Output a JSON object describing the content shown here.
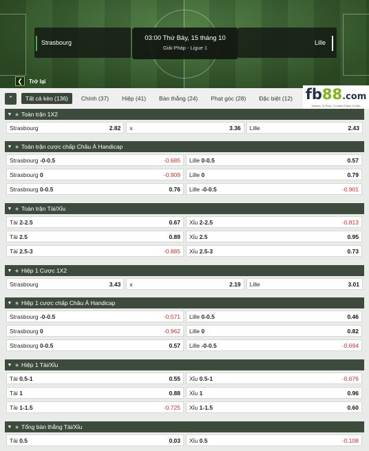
{
  "match": {
    "time": "03:00 Thứ Bảy, 15 tháng 10",
    "league": "Giải Pháp - Ligue 1",
    "home": "Strasbourg",
    "away": "Lille"
  },
  "back_label": "Trở lại",
  "tabs": [
    {
      "label": "Tất cả kèo (136)",
      "active": true
    },
    {
      "label": "Chính (37)"
    },
    {
      "label": "Hiệp (41)"
    },
    {
      "label": "Bàn thắng (24)"
    },
    {
      "label": "Phạt góc (28)"
    },
    {
      "label": "Đặc biệt (12)"
    }
  ],
  "logo": {
    "fb": "fb",
    "n88": "88",
    "com": ".com",
    "tagline": "Games To Play • Trusted Place To Bet"
  },
  "colors": {
    "header_bg": "#3d4b3c",
    "negative": "#d42a2a",
    "brand_green": "#7cb518",
    "active_tab": "#3b463b"
  },
  "sections": [
    {
      "title": "Toàn trận 1X2",
      "type": "1x2",
      "row": [
        {
          "sel": "Strasbourg",
          "odds": "2.82"
        },
        {
          "sel": "x",
          "odds": "3.36"
        },
        {
          "sel": "Lille",
          "odds": "2.43"
        }
      ]
    },
    {
      "title": "Toàn trận cược chấp Châu Á Handicap",
      "type": "pair",
      "rows": [
        [
          {
            "sel": "Strasbourg",
            "line": "-0-0.5",
            "odds": "-0.685"
          },
          {
            "sel": "Lille",
            "line": "0-0.5",
            "odds": "0.57"
          }
        ],
        [
          {
            "sel": "Strasbourg",
            "line": "0",
            "odds": "-0.909"
          },
          {
            "sel": "Lille",
            "line": "0",
            "odds": "0.79"
          }
        ],
        [
          {
            "sel": "Strasbourg",
            "line": "0-0.5",
            "odds": "0.76"
          },
          {
            "sel": "Lille",
            "line": "-0-0.5",
            "odds": "-0.901"
          }
        ]
      ]
    },
    {
      "title": "Toàn trận Tài/Xỉu",
      "type": "pair",
      "rows": [
        [
          {
            "sel": "Tài",
            "line": "2-2.5",
            "odds": "0.67"
          },
          {
            "sel": "Xỉu",
            "line": "2-2.5",
            "odds": "-0.813"
          }
        ],
        [
          {
            "sel": "Tài",
            "line": "2.5",
            "odds": "0.89"
          },
          {
            "sel": "Xỉu",
            "line": "2.5",
            "odds": "0.95"
          }
        ],
        [
          {
            "sel": "Tài",
            "line": "2.5-3",
            "odds": "-0.885"
          },
          {
            "sel": "Xỉu",
            "line": "2.5-3",
            "odds": "0.73"
          }
        ]
      ]
    },
    {
      "title": "Hiệp 1 Cược 1X2",
      "type": "1x2",
      "row": [
        {
          "sel": "Strasbourg",
          "odds": "3.43"
        },
        {
          "sel": "x",
          "odds": "2.19"
        },
        {
          "sel": "Lille",
          "odds": "3.01"
        }
      ]
    },
    {
      "title": "Hiệp 1 cược chấp Châu Á Handicap",
      "type": "pair",
      "rows": [
        [
          {
            "sel": "Strasbourg",
            "line": "-0-0.5",
            "odds": "-0.571"
          },
          {
            "sel": "Lille",
            "line": "0-0.5",
            "odds": "0.46"
          }
        ],
        [
          {
            "sel": "Strasbourg",
            "line": "0",
            "odds": "-0.962"
          },
          {
            "sel": "Lille",
            "line": "0",
            "odds": "0.82"
          }
        ],
        [
          {
            "sel": "Strasbourg",
            "line": "0-0.5",
            "odds": "0.57"
          },
          {
            "sel": "Lille",
            "line": "-0-0.5",
            "odds": "-0.694"
          }
        ]
      ]
    },
    {
      "title": "Hiệp 1 Tài/Xỉu",
      "type": "pair",
      "rows": [
        [
          {
            "sel": "Tài",
            "line": "0.5-1",
            "odds": "0.55"
          },
          {
            "sel": "Xỉu",
            "line": "0.5-1",
            "odds": "-0.676"
          }
        ],
        [
          {
            "sel": "Tài",
            "line": "1",
            "odds": "0.88"
          },
          {
            "sel": "Xỉu",
            "line": "1",
            "odds": "0.96"
          }
        ],
        [
          {
            "sel": "Tài",
            "line": "1-1.5",
            "odds": "-0.725"
          },
          {
            "sel": "Xỉu",
            "line": "1-1.5",
            "odds": "0.60"
          }
        ]
      ]
    },
    {
      "title": "Tổng bàn thắng Tài/Xỉu",
      "type": "pair",
      "rows": [
        [
          {
            "sel": "Tài",
            "line": "0.5",
            "odds": "0.03"
          },
          {
            "sel": "Xỉu",
            "line": "0.5",
            "odds": "-0.108"
          }
        ]
      ]
    }
  ]
}
